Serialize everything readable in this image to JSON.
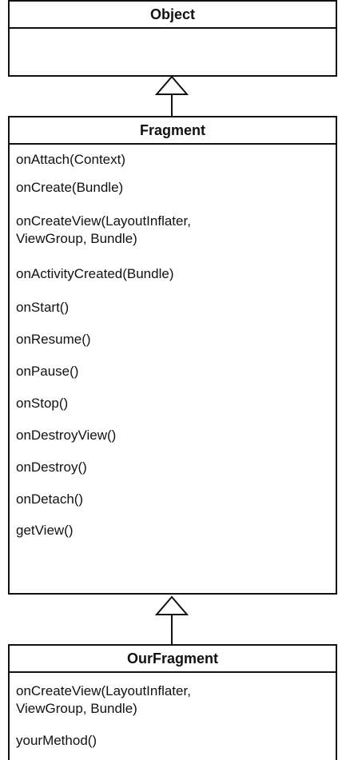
{
  "classes": {
    "object": {
      "name": "Object",
      "methods": []
    },
    "fragment": {
      "name": "Fragment",
      "methods": [
        "onAttach(Context)",
        "onCreate(Bundle)",
        "onCreateView(LayoutInflater,\nViewGroup, Bundle)",
        "onActivityCreated(Bundle)",
        "onStart()",
        "onResume()",
        "onPause()",
        "onStop()",
        "onDestroyView()",
        "onDestroy()",
        "onDetach()",
        "getView()"
      ]
    },
    "our_fragment": {
      "name": "OurFragment",
      "methods": [
        "onCreateView(LayoutInflater,\nViewGroup, Bundle)",
        "yourMethod()"
      ]
    }
  },
  "relations": [
    {
      "from": "Fragment",
      "to": "Object",
      "type": "inheritance"
    },
    {
      "from": "OurFragment",
      "to": "Fragment",
      "type": "inheritance"
    }
  ]
}
